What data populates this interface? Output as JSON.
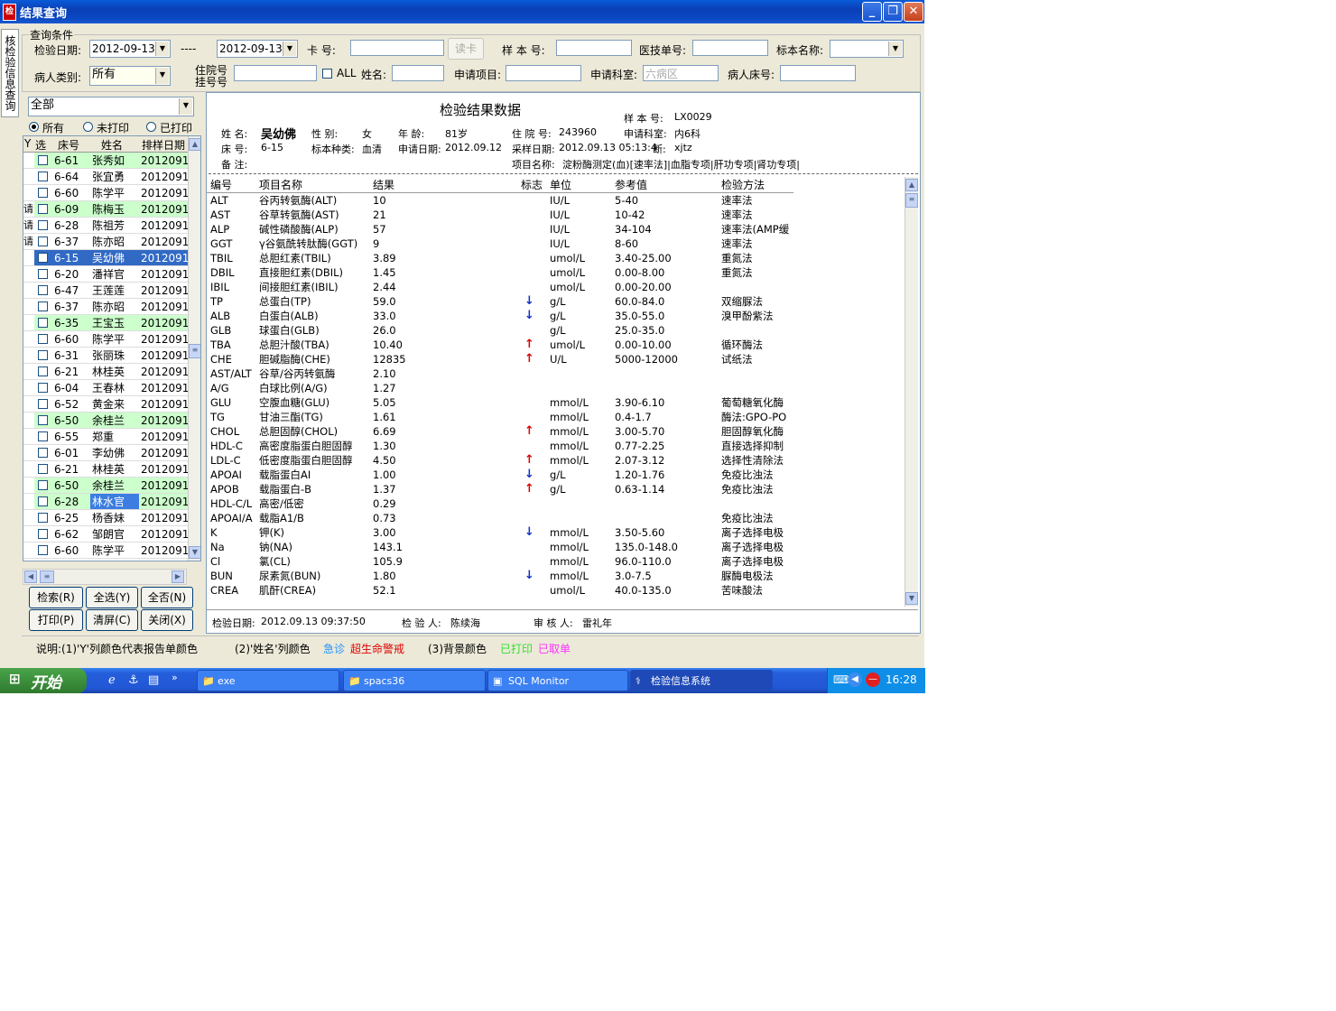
{
  "window": {
    "title": "结果查询"
  },
  "side_tab": "核检验信息查询",
  "query": {
    "group_title": "查询条件",
    "date_label": "检验日期:",
    "date_from": "2012-09-13",
    "date_sep": "----",
    "date_to": "2012-09-13",
    "card_label": "卡  号:",
    "card_value": "",
    "read_card_btn": "读卡",
    "sample_label": "样 本 号:",
    "sample_value": "",
    "doctor_label": "医技单号:",
    "doctor_value": "",
    "specimen_label": "标本名称:",
    "specimen_value": "",
    "patient_type_label": "病人类别:",
    "patient_type_value": "所有",
    "inpatient_label_1": "住院号",
    "inpatient_label_2": "挂号号",
    "inpatient_value": "",
    "all_label": "ALL",
    "name_label": "姓名:",
    "name_value": "",
    "request_item_label": "申请项目:",
    "request_item_value": "",
    "request_dept_label": "申请科室:",
    "request_dept_placeholder": "六病区",
    "bed_label": "病人床号:",
    "bed_value": ""
  },
  "filter": {
    "ward_value": "全部",
    "radios": [
      {
        "label": "所有",
        "checked": true
      },
      {
        "label": "未打印",
        "checked": false
      },
      {
        "label": "已打印",
        "checked": false
      }
    ]
  },
  "patient_list": {
    "columns": [
      "Y",
      "选",
      "床号",
      "姓名",
      "排样日期"
    ],
    "rows": [
      {
        "y": "",
        "bed": "6-61",
        "name": "张秀如",
        "date": "2012091",
        "bg": "#ccffcc",
        "selected": false
      },
      {
        "y": "",
        "bed": "6-64",
        "name": "张宜勇",
        "date": "2012091",
        "bg": "",
        "selected": false
      },
      {
        "y": "",
        "bed": "6-60",
        "name": "陈学平",
        "date": "2012091",
        "bg": "",
        "selected": false
      },
      {
        "y": "请",
        "bed": "6-09",
        "name": "陈梅玉",
        "date": "2012091",
        "bg": "#ccffcc",
        "selected": false
      },
      {
        "y": "请",
        "bed": "6-28",
        "name": "陈祖芳",
        "date": "2012091",
        "bg": "",
        "selected": false
      },
      {
        "y": "请",
        "bed": "6-37",
        "name": "陈亦昭",
        "date": "2012091",
        "bg": "",
        "selected": false
      },
      {
        "y": "",
        "bed": "6-15",
        "name": "吴幼佛",
        "date": "2012091",
        "bg": "",
        "selected": true
      },
      {
        "y": "",
        "bed": "6-20",
        "name": "潘祥官",
        "date": "2012091",
        "bg": "",
        "selected": false
      },
      {
        "y": "",
        "bed": "6-47",
        "name": "王莲莲",
        "date": "2012091",
        "bg": "",
        "selected": false
      },
      {
        "y": "",
        "bed": "6-37",
        "name": "陈亦昭",
        "date": "2012091",
        "bg": "",
        "selected": false
      },
      {
        "y": "",
        "bed": "6-35",
        "name": "王宝玉",
        "date": "2012091",
        "bg": "#ccffcc",
        "selected": false
      },
      {
        "y": "",
        "bed": "6-60",
        "name": "陈学平",
        "date": "2012091",
        "bg": "",
        "selected": false
      },
      {
        "y": "",
        "bed": "6-31",
        "name": "张丽珠",
        "date": "2012091",
        "bg": "",
        "selected": false
      },
      {
        "y": "",
        "bed": "6-21",
        "name": "林桂英",
        "date": "2012091",
        "bg": "",
        "selected": false
      },
      {
        "y": "",
        "bed": "6-04",
        "name": "王春林",
        "date": "2012091",
        "bg": "",
        "selected": false
      },
      {
        "y": "",
        "bed": "6-52",
        "name": "黄金来",
        "date": "2012091",
        "bg": "",
        "selected": false
      },
      {
        "y": "",
        "bed": "6-50",
        "name": "余桂兰",
        "date": "2012091",
        "bg": "#ccffcc",
        "selected": false
      },
      {
        "y": "",
        "bed": "6-55",
        "name": "郑重",
        "date": "2012091",
        "bg": "",
        "selected": false
      },
      {
        "y": "",
        "bed": "6-01",
        "name": "李幼佛",
        "date": "2012091",
        "bg": "",
        "selected": false
      },
      {
        "y": "",
        "bed": "6-21",
        "name": "林桂英",
        "date": "2012091",
        "bg": "",
        "selected": false
      },
      {
        "y": "",
        "bed": "6-50",
        "name": "余桂兰",
        "date": "2012091",
        "bg": "#ccffcc",
        "selected": false
      },
      {
        "y": "",
        "bed": "6-28",
        "name": "林水官",
        "date": "2012091",
        "bg": "#ccffcc",
        "selected": false,
        "name_bg": "#3b7de0"
      },
      {
        "y": "",
        "bed": "6-25",
        "name": "杨香妹",
        "date": "2012091",
        "bg": "",
        "selected": false
      },
      {
        "y": "",
        "bed": "6-62",
        "name": "邹朗官",
        "date": "2012091",
        "bg": "",
        "selected": false
      },
      {
        "y": "",
        "bed": "6-60",
        "name": "陈学平",
        "date": "2012091",
        "bg": "",
        "selected": false
      }
    ]
  },
  "buttons": {
    "search": "检索(R)",
    "select_all": "全选(Y)",
    "select_none": "全否(N)",
    "print": "打印(P)",
    "clear": "清屏(C)",
    "close": "关闭(X)"
  },
  "report": {
    "title": "检验结果数据",
    "sample_no_label": "样 本 号:",
    "sample_no": "LX0029",
    "name_label": "姓  名:",
    "name": "吴幼佛",
    "sex_label": "性  别:",
    "sex": "女",
    "age_label": "年  龄:",
    "age": "81岁",
    "inpatient_label": "住 院 号:",
    "inpatient_no": "243960",
    "dept_label": "申请科室:",
    "dept": "内6科",
    "bed_label": "床  号:",
    "bed": "6-15",
    "specimen_label": "标本种类:",
    "specimen": "血清",
    "request_date_label": "申请日期:",
    "request_date": "2012.09.12",
    "sample_date_label": "采样日期:",
    "sample_date": "2012.09.13 05:13:4",
    "diag_label": "断:",
    "diag": "xjtz",
    "note_label": "备  注:",
    "note": "",
    "items_label": "项目名称:",
    "items": "淀粉酶测定(血)[速率法]|血脂专项|肝功专项|肾功专项|",
    "columns": [
      "编号",
      "项目名称",
      "结果",
      "标志",
      "单位",
      "参考值",
      "检验方法"
    ],
    "rows": [
      {
        "code": "ALT",
        "name": "谷丙转氨酶(ALT)",
        "result": "10",
        "flag": "",
        "unit": "IU/L",
        "ref": "5-40",
        "method": "速率法"
      },
      {
        "code": "AST",
        "name": "谷草转氨酶(AST)",
        "result": "21",
        "flag": "",
        "unit": "IU/L",
        "ref": "10-42",
        "method": "速率法"
      },
      {
        "code": "ALP",
        "name": "碱性磷酸酶(ALP)",
        "result": "57",
        "flag": "",
        "unit": "IU/L",
        "ref": "34-104",
        "method": "速率法(AMP缓"
      },
      {
        "code": "GGT",
        "name": "γ谷氨酰转肽酶(GGT)",
        "result": "9",
        "flag": "",
        "unit": "IU/L",
        "ref": "8-60",
        "method": "速率法"
      },
      {
        "code": "TBIL",
        "name": "总胆红素(TBIL)",
        "result": "3.89",
        "flag": "",
        "unit": "umol/L",
        "ref": "3.40-25.00",
        "method": "重氮法"
      },
      {
        "code": "DBIL",
        "name": "直接胆红素(DBIL)",
        "result": "1.45",
        "flag": "",
        "unit": "umol/L",
        "ref": "0.00-8.00",
        "method": "重氮法"
      },
      {
        "code": "IBIL",
        "name": "间接胆红素(IBIL)",
        "result": "2.44",
        "flag": "",
        "unit": "umol/L",
        "ref": "0.00-20.00",
        "method": ""
      },
      {
        "code": "TP",
        "name": "总蛋白(TP)",
        "result": "59.0",
        "flag": "↓",
        "unit": "g/L",
        "ref": "60.0-84.0",
        "method": "双缩脲法"
      },
      {
        "code": "ALB",
        "name": "白蛋白(ALB)",
        "result": "33.0",
        "flag": "↓",
        "unit": "g/L",
        "ref": "35.0-55.0",
        "method": "溴甲酚紫法"
      },
      {
        "code": "GLB",
        "name": "球蛋白(GLB)",
        "result": "26.0",
        "flag": "",
        "unit": "g/L",
        "ref": "25.0-35.0",
        "method": ""
      },
      {
        "code": "TBA",
        "name": "总胆汁酸(TBA)",
        "result": "10.40",
        "flag": "↑",
        "unit": "umol/L",
        "ref": "0.00-10.00",
        "method": "循环酶法"
      },
      {
        "code": "CHE",
        "name": "胆碱脂酶(CHE)",
        "result": "12835",
        "flag": "↑",
        "unit": "U/L",
        "ref": "5000-12000",
        "method": "试纸法"
      },
      {
        "code": "AST/ALT",
        "name": "谷草/谷丙转氨酶",
        "result": "2.10",
        "flag": "",
        "unit": "",
        "ref": "",
        "method": ""
      },
      {
        "code": "A/G",
        "name": "白球比例(A/G)",
        "result": "1.27",
        "flag": "",
        "unit": "",
        "ref": "",
        "method": ""
      },
      {
        "code": "GLU",
        "name": "空腹血糖(GLU)",
        "result": "5.05",
        "flag": "",
        "unit": "mmol/L",
        "ref": "3.90-6.10",
        "method": "葡萄糖氧化酶"
      },
      {
        "code": "TG",
        "name": "甘油三酯(TG)",
        "result": "1.61",
        "flag": "",
        "unit": "mmol/L",
        "ref": "0.4-1.7",
        "method": "酶法:GPO-PO"
      },
      {
        "code": "CHOL",
        "name": "总胆固醇(CHOL)",
        "result": "6.69",
        "flag": "↑",
        "unit": "mmol/L",
        "ref": "3.00-5.70",
        "method": "胆固醇氧化酶"
      },
      {
        "code": "HDL-C",
        "name": "高密度脂蛋白胆固醇",
        "result": "1.30",
        "flag": "",
        "unit": "mmol/L",
        "ref": "0.77-2.25",
        "method": "直接选择抑制"
      },
      {
        "code": "LDL-C",
        "name": "低密度脂蛋白胆固醇",
        "result": "4.50",
        "flag": "↑",
        "unit": "mmol/L",
        "ref": "2.07-3.12",
        "method": "选择性清除法"
      },
      {
        "code": "APOAI",
        "name": "载脂蛋白AI",
        "result": "1.00",
        "flag": "↓",
        "unit": "g/L",
        "ref": "1.20-1.76",
        "method": "免疫比浊法"
      },
      {
        "code": "APOB",
        "name": "载脂蛋白-B",
        "result": "1.37",
        "flag": "↑",
        "unit": "g/L",
        "ref": "0.63-1.14",
        "method": "免疫比浊法"
      },
      {
        "code": "HDL-C/L",
        "name": "高密/低密",
        "result": "0.29",
        "flag": "",
        "unit": "",
        "ref": "",
        "method": ""
      },
      {
        "code": "APOAI/A",
        "name": "载脂A1/B",
        "result": "0.73",
        "flag": "",
        "unit": "",
        "ref": "",
        "method": "免疫比浊法"
      },
      {
        "code": "K",
        "name": "钾(K)",
        "result": "3.00",
        "flag": "↓",
        "unit": "mmol/L",
        "ref": "3.50-5.60",
        "method": "离子选择电极"
      },
      {
        "code": "Na",
        "name": "钠(NA)",
        "result": "143.1",
        "flag": "",
        "unit": "mmol/L",
        "ref": "135.0-148.0",
        "method": "离子选择电极"
      },
      {
        "code": "Cl",
        "name": "氯(CL)",
        "result": "105.9",
        "flag": "",
        "unit": "mmol/L",
        "ref": "96.0-110.0",
        "method": "离子选择电极"
      },
      {
        "code": "BUN",
        "name": "尿素氮(BUN)",
        "result": "1.80",
        "flag": "↓",
        "unit": "mmol/L",
        "ref": "3.0-7.5",
        "method": "脲酶电极法"
      },
      {
        "code": "CREA",
        "name": "肌酐(CREA)",
        "result": "52.1",
        "flag": "",
        "unit": "umol/L",
        "ref": "40.0-135.0",
        "method": "苦味酸法"
      }
    ],
    "footer": {
      "test_date_label": "检验日期:",
      "test_date": "2012.09.13 09:37:50",
      "tester_label": "检 验 人:",
      "tester": "陈续海",
      "reviewer_label": "审 核 人:",
      "reviewer": "雷礼年"
    }
  },
  "legend": {
    "part1": "说明:(1)'Y'列颜色代表报告单颜色",
    "part2": "(2)'姓名'列颜色",
    "urgent": "急诊",
    "critical": "超生命警戒",
    "part3": "(3)背景颜色",
    "printed": "已打印",
    "cancelled": "已取单",
    "colors": {
      "urgent": "#1e90ff",
      "critical": "#e00000",
      "printed": "#33dd33",
      "cancelled": "#ff33ff"
    }
  },
  "taskbar": {
    "start": "开始",
    "tasks": [
      {
        "label": "exe",
        "icon": "folder-icon",
        "active": false
      },
      {
        "label": "spacs36",
        "icon": "folder-icon",
        "active": false
      },
      {
        "label": "SQL Monitor",
        "icon": "monitor-icon",
        "active": false
      },
      {
        "label": "检验信息系统",
        "icon": "app-icon",
        "active": true
      }
    ],
    "clock": "16:28"
  }
}
